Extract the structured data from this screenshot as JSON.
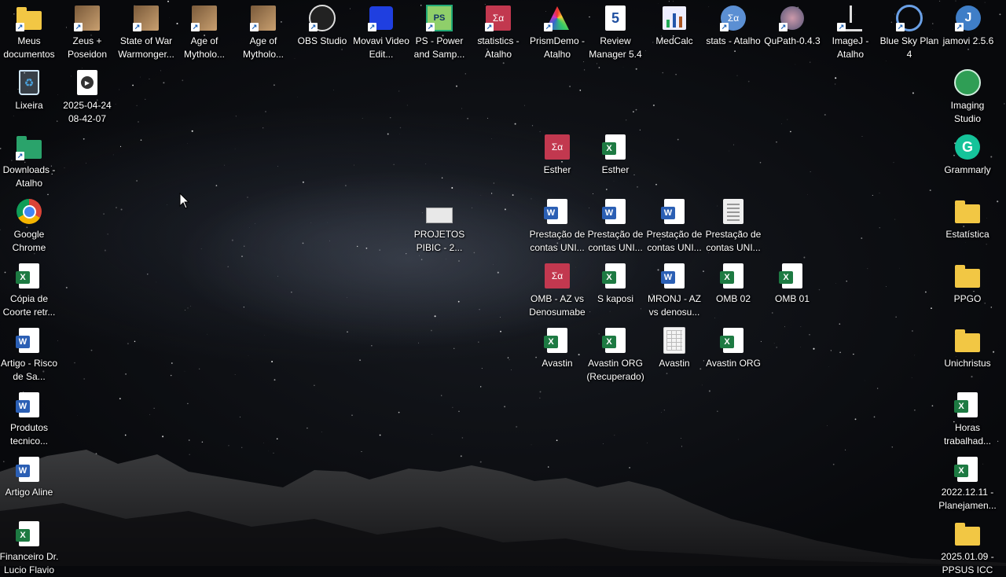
{
  "colors": {
    "word": "#2b5fb4",
    "excel": "#1d7a42",
    "folder": "#f2c744",
    "stat_pink": "#c2384f",
    "shortcut_arrow": "#1a5fb4"
  },
  "left_column": [
    {
      "label": "Meus documentos",
      "icon": "folder-documents-icon"
    },
    {
      "label": "Lixeira",
      "icon": "recycle-bin-icon"
    },
    {
      "label": "Downloads - Atalho",
      "icon": "folder-downloads-icon"
    },
    {
      "label": "Google Chrome",
      "icon": "chrome-icon"
    },
    {
      "label": "Cópia de Coorte retr...",
      "icon": "excel-icon"
    },
    {
      "label": "Artigo - Risco de Sa...",
      "icon": "word-icon"
    },
    {
      "label": "Produtos tecnico...",
      "icon": "word-icon"
    },
    {
      "label": "Artigo Aline",
      "icon": "word-icon"
    },
    {
      "label": "Financeiro Dr. Lucio Flavio",
      "icon": "excel-icon"
    }
  ],
  "top_row": [
    {
      "label": "Zeus + Poseidon",
      "icon": "game-zeus-icon"
    },
    {
      "label": "State of War Warmonger...",
      "icon": "game-sow-icon"
    },
    {
      "label": "Age of Mytholo...",
      "icon": "game-aom-icon"
    },
    {
      "label": "Age of Mytholo...",
      "icon": "game-aom2-icon"
    },
    {
      "label": "OBS Studio",
      "icon": "obs-icon"
    },
    {
      "label": "Movavi Video Edit...",
      "icon": "movavi-icon"
    },
    {
      "label": "PS - Power and Samp...",
      "icon": "ps-power-icon"
    },
    {
      "label": "statistics - Atalho",
      "icon": "statistics-icon"
    },
    {
      "label": "PrismDemo - Atalho",
      "icon": "prism-icon"
    },
    {
      "label": "Review Manager 5.4",
      "icon": "review-manager-icon"
    },
    {
      "label": "MedCalc",
      "icon": "medcalc-icon"
    },
    {
      "label": "stats - Atalho",
      "icon": "stats-icon"
    },
    {
      "label": "QuPath-0.4.3",
      "icon": "qupath-icon"
    },
    {
      "label": "ImageJ - Atalho",
      "icon": "imagej-icon"
    },
    {
      "label": "Blue Sky Plan 4",
      "icon": "bluesky-icon"
    },
    {
      "label": "jamovi 2.5.6",
      "icon": "jamovi-icon"
    }
  ],
  "video_file": {
    "label": "2025-04-24 08-42-07",
    "icon": "video-file-icon"
  },
  "center": [
    {
      "label": "Esther",
      "icon": "statistics-file-icon"
    },
    {
      "label": "Esther",
      "icon": "excel-icon"
    },
    {
      "label": "PROJETOS PIBIC - 2...",
      "icon": "document-thumbnail-icon"
    },
    {
      "label": "Prestação de contas UNI...",
      "icon": "word-icon"
    },
    {
      "label": "Prestação de contas UNI...",
      "icon": "word-icon"
    },
    {
      "label": "Prestação de contas UNI...",
      "icon": "word-icon"
    },
    {
      "label": "Prestação de contas UNI...",
      "icon": "text-document-icon"
    },
    {
      "label": "OMB - AZ vs Denosumabe",
      "icon": "statistics-file-icon"
    },
    {
      "label": "S kaposi",
      "icon": "excel-icon"
    },
    {
      "label": "MRONJ - AZ vs denosu...",
      "icon": "word-icon"
    },
    {
      "label": "OMB 02",
      "icon": "excel-icon"
    },
    {
      "label": "OMB 01",
      "icon": "excel-icon"
    },
    {
      "label": "Avastin",
      "icon": "excel-icon"
    },
    {
      "label": "Avastin ORG (Recuperado)",
      "icon": "excel-icon"
    },
    {
      "label": "Avastin",
      "icon": "table-document-icon"
    },
    {
      "label": "Avastin ORG",
      "icon": "excel-icon"
    }
  ],
  "right_column": [
    {
      "label": "Imaging Studio",
      "icon": "imaging-studio-icon"
    },
    {
      "label": "Grammarly",
      "icon": "grammarly-icon"
    },
    {
      "label": "Estatística",
      "icon": "folder-icon"
    },
    {
      "label": "PPGO",
      "icon": "folder-icon"
    },
    {
      "label": "Unichristus",
      "icon": "folder-icon"
    },
    {
      "label": "Horas trabalhad...",
      "icon": "excel-icon"
    },
    {
      "label": "2022.12.11 - Planejamen...",
      "icon": "excel-icon"
    },
    {
      "label": "2025.01.09 - PPSUS ICC",
      "icon": "folder-icon"
    }
  ]
}
